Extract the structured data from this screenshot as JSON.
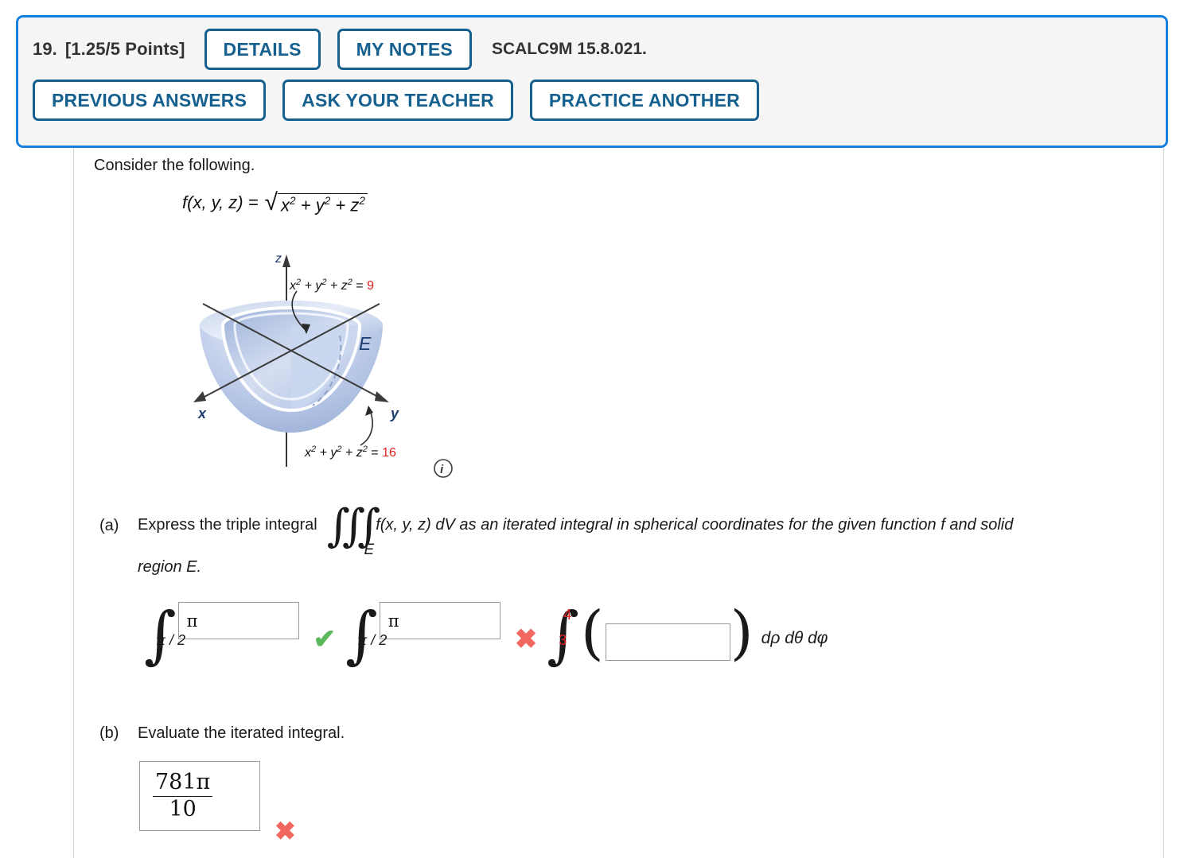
{
  "header": {
    "question_number": "19.",
    "points": "[1.25/5 Points]",
    "details_button": "DETAILS",
    "my_notes_button": "MY NOTES",
    "problem_code": "SCALC9M 15.8.021.",
    "previous_answers_button": "PREVIOUS ANSWERS",
    "ask_your_teacher_button": "ASK YOUR TEACHER",
    "practice_another_button": "PRACTICE ANOTHER",
    "border_color": "#1580dd",
    "panel_bg": "#f5f5f5",
    "button_color": "#15608f"
  },
  "body": {
    "consider": "Consider the following.",
    "function": {
      "lhs": "f(x, y, z) =",
      "radical_symbol": "√",
      "radicand_x": "x",
      "radicand_y": "y",
      "radicand_z": "z",
      "exponent": "2",
      "plus": "+"
    },
    "figure": {
      "axis_z": "z",
      "axis_x": "x",
      "axis_y": "y",
      "region_label": "E",
      "inner_sphere_eq_lhs": "x2 + y2 + z2 =",
      "inner_sphere_value": "9",
      "outer_sphere_eq_lhs": "x2 + y2 + z2 =",
      "outer_sphere_value": "16",
      "info_icon": "i",
      "value_color": "#e02020",
      "surface_color_light": "#dde5f4",
      "surface_color_mid": "#aebfe2",
      "surface_color_dark": "#8ba1ce"
    }
  },
  "part_a": {
    "label": "(a)",
    "text_before_integral": "Express the triple integral",
    "integral_subscript": "E",
    "text_after_integral": "f(x, y, z) dV as an iterated integral in spherical coordinates for the given function f and solid",
    "text_line2": "region E.",
    "integrals": [
      {
        "lower_limit": "π / 2",
        "upper_value": "π",
        "status": "correct",
        "status_mark": "✔"
      },
      {
        "lower_limit": "π / 2",
        "upper_value": "π",
        "status": "incorrect",
        "status_mark": "✖"
      },
      {
        "lower_limit": "3",
        "upper_limit": "4",
        "integrand_value": "",
        "status": "none"
      }
    ],
    "differentials": "dρ dθ dφ"
  },
  "part_b": {
    "label": "(b)",
    "text": "Evaluate the iterated integral.",
    "answer_numerator": "781π",
    "answer_denominator": "10",
    "status": "incorrect",
    "status_mark": "✖"
  },
  "colors": {
    "correct": "#5cb85c",
    "incorrect": "#f2675f"
  }
}
